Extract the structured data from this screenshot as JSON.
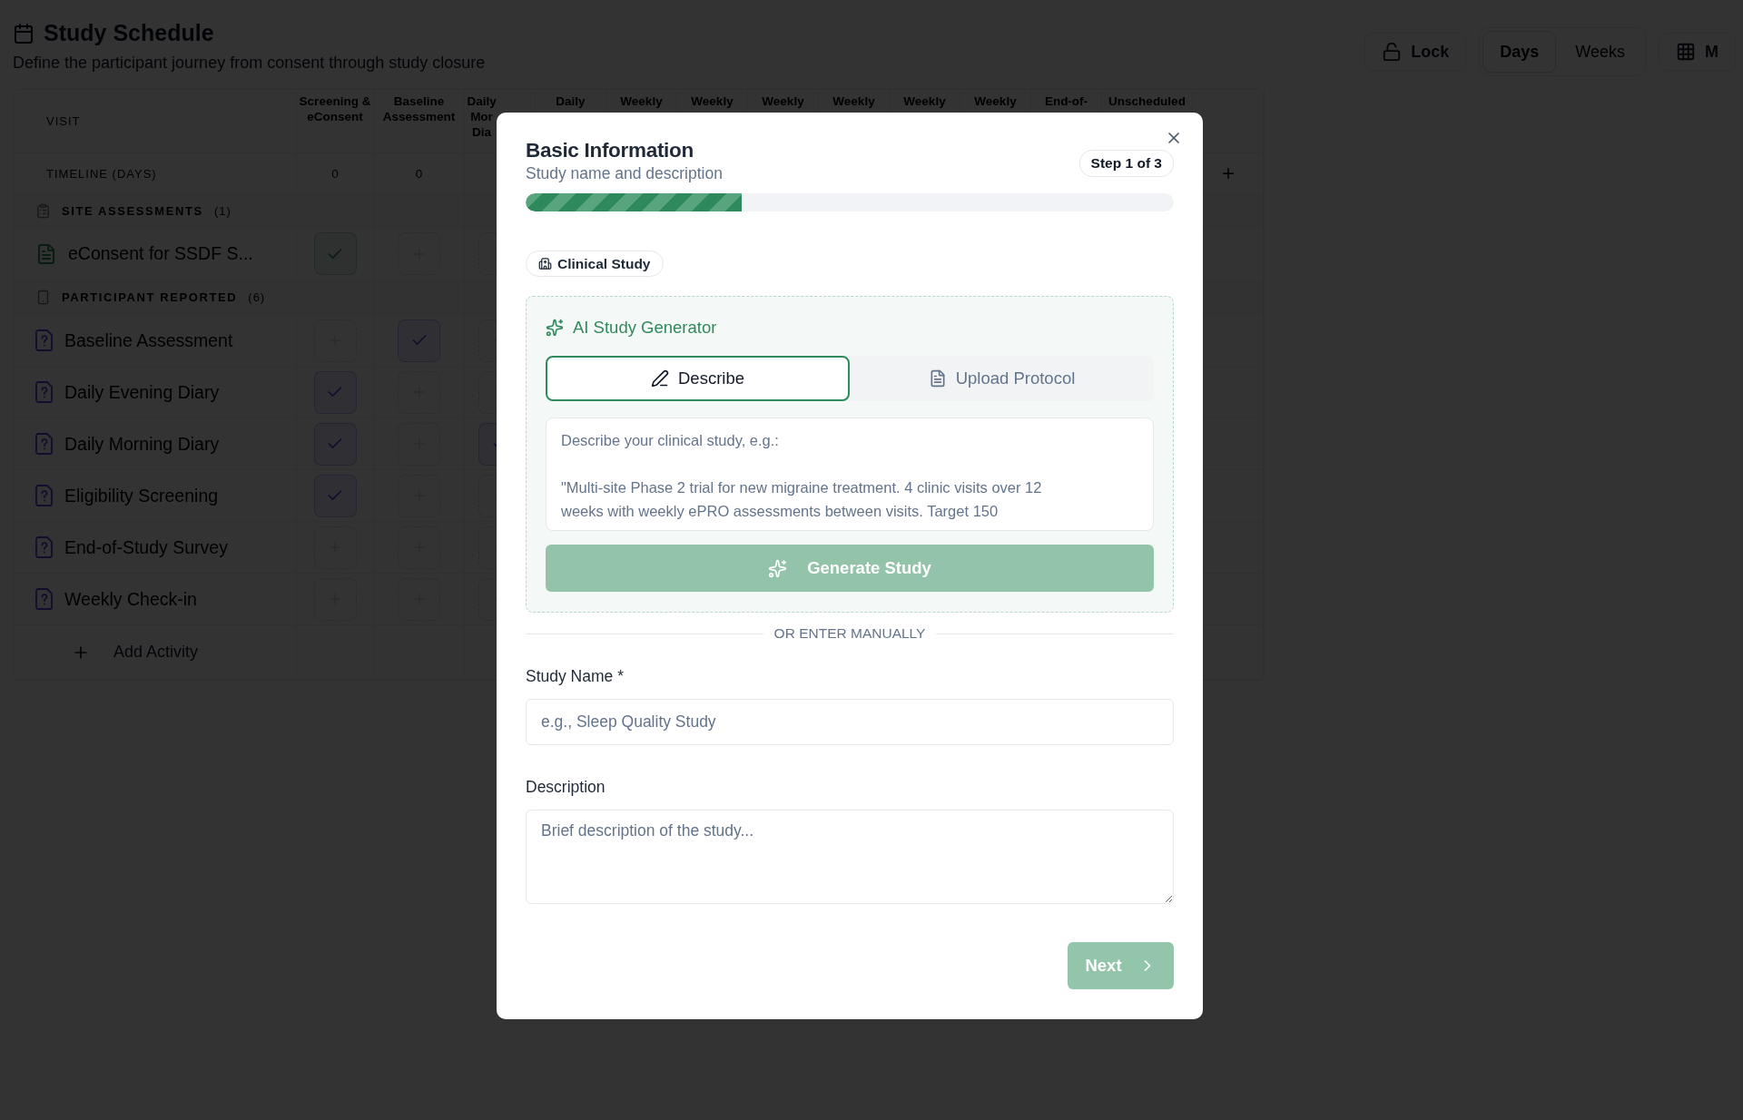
{
  "page": {
    "title": "Study Schedule",
    "subtitle": "Define the participant journey from consent through study closure"
  },
  "toolbar": {
    "lock_button": "Lock",
    "view_toggle": [
      {
        "label": "Days",
        "selected": true
      },
      {
        "label": "Weeks",
        "selected": false
      }
    ],
    "grid_button": "M"
  },
  "schedule": {
    "visit_header": "VISIT",
    "timeline_header": "TIMELINE (DAYS)",
    "add_visit": "+",
    "visits": [
      {
        "name": "Screening & eConsent",
        "day": "0"
      },
      {
        "name": "Baseline Assessment",
        "day": "0"
      },
      {
        "name": "Daily Mor Dia"
      },
      {
        "name": "Daily"
      },
      {
        "name": "Weekly"
      },
      {
        "name": "Weekly"
      },
      {
        "name": "Weekly"
      },
      {
        "name": "Weekly"
      },
      {
        "name": "Weekly"
      },
      {
        "name": "Weekly"
      },
      {
        "name": "End-of-"
      },
      {
        "name": "Unscheduled"
      }
    ],
    "sections": [
      {
        "kind": "site",
        "title": "SITE ASSESSMENTS",
        "count": "(1)",
        "activities": [
          {
            "name": "eConsent for SSDF S...",
            "cells": [
              {
                "checked": true
              },
              {
                "checked": false
              },
              {
                "checked": false
              }
            ]
          }
        ]
      },
      {
        "kind": "participant",
        "title": "PARTICIPANT REPORTED",
        "count": "(6)",
        "activities": [
          {
            "name": "Baseline Assessment",
            "cells": [
              {
                "checked": false
              },
              {
                "checked": true
              },
              {
                "checked": false
              }
            ]
          },
          {
            "name": "Daily Evening Diary",
            "cells": [
              {
                "checked": true
              },
              {
                "checked": false
              },
              {
                "checked": false
              }
            ]
          },
          {
            "name": "Daily Morning Diary",
            "cells": [
              {
                "checked": true
              },
              {
                "checked": false
              },
              {
                "checked": true
              }
            ]
          },
          {
            "name": "Eligibility Screening",
            "cells": [
              {
                "checked": true
              },
              {
                "checked": false
              },
              {
                "checked": false
              }
            ]
          },
          {
            "name": "End-of-Study Survey",
            "cells": [
              {
                "checked": false
              },
              {
                "checked": false
              },
              {
                "checked": false
              }
            ]
          },
          {
            "name": "Weekly Check-in",
            "cells": [
              {
                "checked": false
              },
              {
                "checked": false
              },
              {
                "checked": false
              }
            ]
          }
        ]
      }
    ],
    "add_activity": "Add Activity"
  },
  "modal": {
    "title": "Basic Information",
    "subtitle": "Study name and description",
    "step": "Step 1 of 3",
    "progress": {
      "level": 0.333
    },
    "study_type": "Clinical Study",
    "ai_generator": {
      "title": "AI Study Generator",
      "tabs": [
        {
          "label": "Describe",
          "selected": true
        },
        {
          "label": "Upload Protocol",
          "selected": false
        }
      ],
      "prompt": {
        "placeholder": "Describe your clinical study, e.g.:\n\n\"Multi-site Phase 2 trial for new migraine treatment. 4 clinic visits over 12\nweeks with weekly ePRO assessments between visits. Target 150"
      },
      "generate_button": {
        "label": "Generate Study",
        "disabled": true
      }
    },
    "divider": "OR ENTER MANUALLY",
    "fields": [
      {
        "kind": "input",
        "label": "Study Name *",
        "placeholder": "e.g., Sleep Quality Study"
      },
      {
        "kind": "textarea",
        "label": "Description",
        "placeholder": "Brief description of the study..."
      }
    ],
    "next_button": {
      "label": "Next",
      "disabled": true
    }
  }
}
